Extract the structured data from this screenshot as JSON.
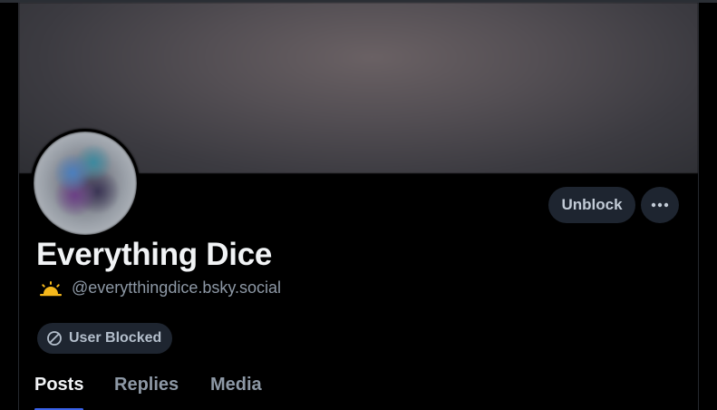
{
  "profile": {
    "display_name": "Everything Dice",
    "handle": "@everytthingdice.bsky.social",
    "status_emoji_name": "sun-icon"
  },
  "actions": {
    "unblock_label": "Unblock",
    "more_icon": "ellipsis-icon"
  },
  "badge": {
    "label": "User Blocked",
    "icon": "ban-icon"
  },
  "tabs": [
    {
      "label": "Posts",
      "active": true
    },
    {
      "label": "Replies",
      "active": false
    },
    {
      "label": "Media",
      "active": false
    }
  ],
  "colors": {
    "accent": "#3a62e8",
    "button_bg": "#1e2530",
    "muted_text": "#8d98a5"
  }
}
